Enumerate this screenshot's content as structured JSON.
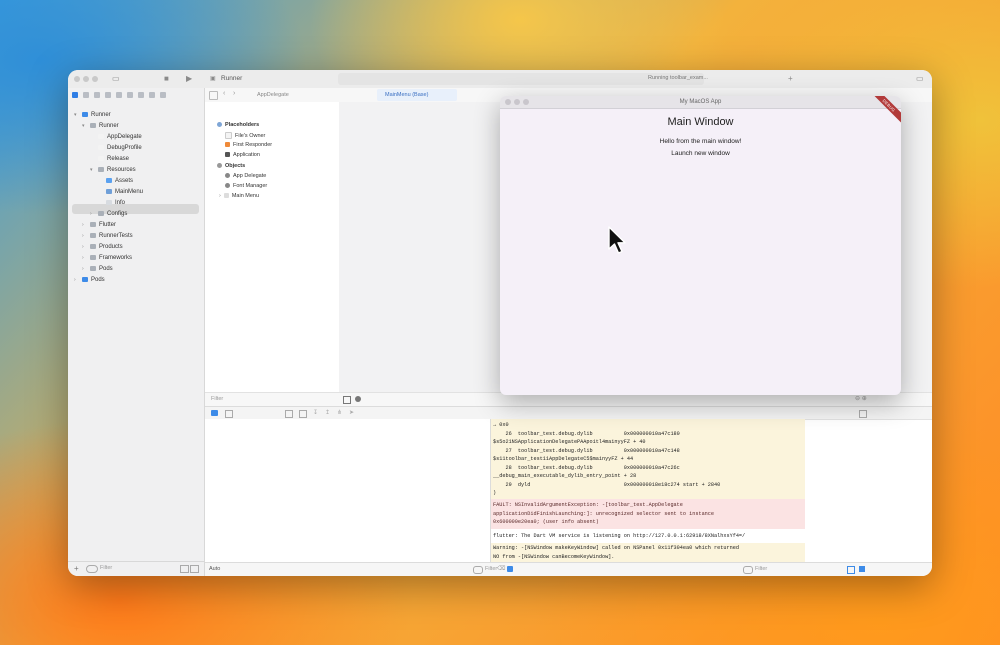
{
  "xcode": {
    "scheme": "Runner",
    "status": "Running toolbar_exam...",
    "nav_filter_placeholder": "Filter"
  },
  "tree": [
    {
      "label": "Runner",
      "icon": "project-icon"
    },
    {
      "label": "Runner",
      "icon": "folder-icon"
    },
    {
      "label": "AppDelegate",
      "icon": "swift-file-icon"
    },
    {
      "label": "DebugProfile",
      "icon": "entitlements-file-icon"
    },
    {
      "label": "Release",
      "icon": "entitlements-file-icon"
    },
    {
      "label": "Resources",
      "icon": "folder-icon"
    },
    {
      "label": "Assets",
      "icon": "asset-catalog-icon"
    },
    {
      "label": "MainMenu",
      "icon": "xib-file-icon"
    },
    {
      "label": "Info",
      "icon": "plist-file-icon"
    },
    {
      "label": "Configs",
      "icon": "folder-icon"
    },
    {
      "label": "Flutter",
      "icon": "folder-icon"
    },
    {
      "label": "RunnerTests",
      "icon": "folder-icon"
    },
    {
      "label": "Products",
      "icon": "folder-icon"
    },
    {
      "label": "Frameworks",
      "icon": "folder-icon"
    },
    {
      "label": "Pods",
      "icon": "folder-icon"
    },
    {
      "label": "Pods",
      "icon": "project-icon"
    }
  ],
  "editor": {
    "tab": "AppDelegate",
    "tab_active": "MainMenu (Base)"
  },
  "ib_outline": {
    "placeholders_header": "Placeholders",
    "placeholders": [
      "File's Owner",
      "First Responder",
      "Application"
    ],
    "objects_header": "Objects",
    "objects": [
      "App Delegate",
      "Font Manager",
      "Main Menu"
    ],
    "filter_placeholder": "Filter"
  },
  "console": {
    "lines1": [
      "→ 0x0",
      "    26  toolbar_test.debug.dylib          0x000000010a47c180",
      "$s5o21NSApplicationDelegatePAApoitl4mainyyFZ + 40",
      "    27  toolbar_test.debug.dylib          0x000000010a47c148",
      "$s11toolbar_test11AppDelegateC5$mainyyFZ + 44",
      "    28  toolbar_test.debug.dylib          0x000000010a47c26c",
      "__debug_main_executable_dylib_entry_point + 28",
      "    29  dyld                              0x000000018e18c274 start + 2840",
      ")"
    ],
    "fault": [
      "FAULT: NSInvalidArgumentException: -[toolbar_test.AppDelegate",
      "applicationDidFinishLaunching:]: unrecognized selector sent to instance",
      "0x600000e20ea0; (user info absent)"
    ],
    "flutter": "flutter: The Dart VM service is listening on http://127.0.0.1:62918/8XNalhxsYf4=/",
    "warning": [
      "Warning: -[NSWindow makeKeyWindow] called on NSPanel 0x11f304ea0 which returned",
      "NO from -[NSWindow canBecomeKeyWindow]."
    ],
    "filter_placeholder": "Filter",
    "auto_label": "Auto"
  },
  "app_window": {
    "title": "My MacOS App",
    "heading": "Main Window",
    "message": "Hello from the main window!",
    "launch_label": "Launch new window",
    "banner": "DEBUG"
  }
}
